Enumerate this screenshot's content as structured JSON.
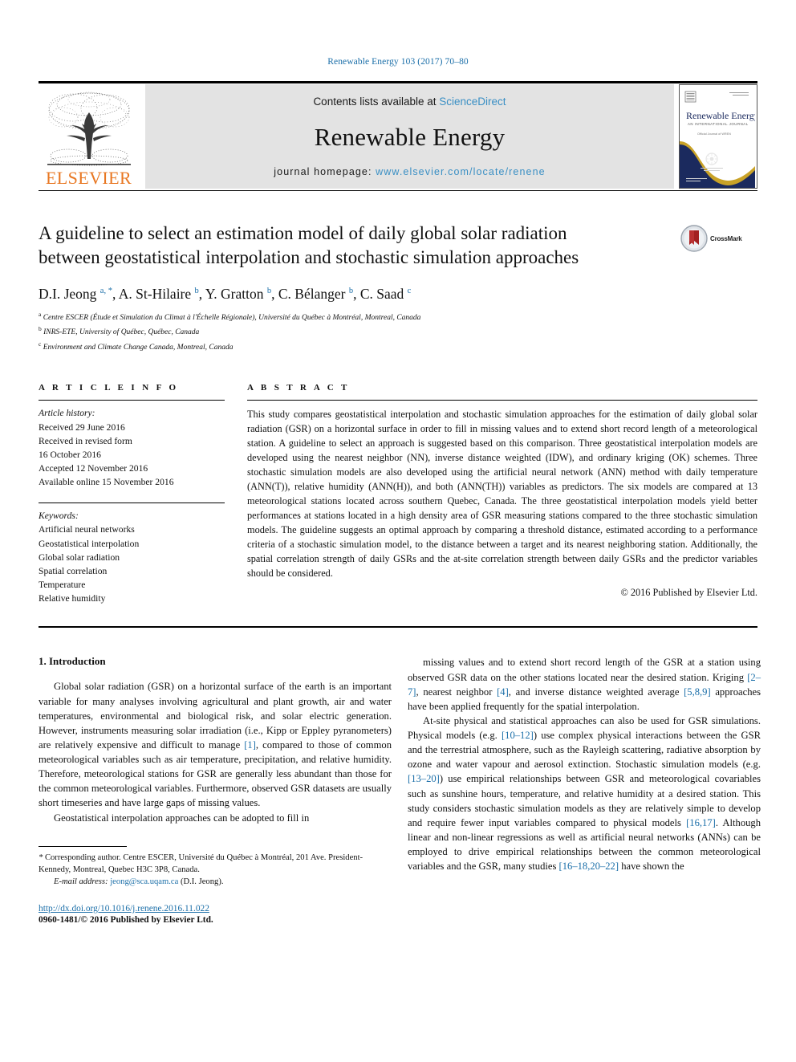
{
  "running_head": "Renewable Energy 103 (2017) 70–80",
  "masthead": {
    "publisher_name": "ELSEVIER",
    "contents_prefix": "Contents lists available at ",
    "contents_link": "ScienceDirect",
    "journal_title": "Renewable Energy",
    "homepage_prefix": "journal homepage: ",
    "homepage_url": "www.elsevier.com/locate/renene",
    "cover": {
      "title": "Renewable Energy",
      "subtitle": "AN INTERNATIONAL JOURNAL",
      "tagline": "Official Journal of WREN"
    }
  },
  "article": {
    "title": "A guideline to select an estimation model of daily global solar radiation between geostatistical interpolation and stochastic simulation approaches",
    "authors_html": "D.I. Jeong <sup>a, *</sup>, A. St-Hilaire <sup>b</sup>, Y. Gratton <sup>b</sup>, C. Bélanger <sup>b</sup>, C. Saad <sup>c</sup>",
    "affiliations": [
      "a Centre ESCER (Étude et Simulation du Climat à l'Échelle Régionale), Université du Québec à Montréal, Montreal, Canada",
      "b INRS-ETE, University of Québec, Québec, Canada",
      "c Environment and Climate Change Canada, Montreal, Canada"
    ],
    "crossmark_label": "CrossMark"
  },
  "article_info": {
    "heading": "A R T I C L E   I N F O",
    "history_label": "Article history:",
    "history": [
      "Received 29 June 2016",
      "Received in revised form",
      "16 October 2016",
      "Accepted 12 November 2016",
      "Available online 15 November 2016"
    ],
    "keywords_label": "Keywords:",
    "keywords": [
      "Artificial neural networks",
      "Geostatistical interpolation",
      "Global solar radiation",
      "Spatial correlation",
      "Temperature",
      "Relative humidity"
    ]
  },
  "abstract": {
    "heading": "A B S T R A C T",
    "text": "This study compares geostatistical interpolation and stochastic simulation approaches for the estimation of daily global solar radiation (GSR) on a horizontal surface in order to fill in missing values and to extend short record length of a meteorological station. A guideline to select an approach is suggested based on this comparison. Three geostatistical interpolation models are developed using the nearest neighbor (NN), inverse distance weighted (IDW), and ordinary kriging (OK) schemes. Three stochastic simulation models are also developed using the artificial neural network (ANN) method with daily temperature (ANN(T)), relative humidity (ANN(H)), and both (ANN(TH)) variables as predictors. The six models are compared at 13 meteorological stations located across southern Quebec, Canada. The three geostatistical interpolation models yield better performances at stations located in a high density area of GSR measuring stations compared to the three stochastic simulation models. The guideline suggests an optimal approach by comparing a threshold distance, estimated according to a performance criteria of a stochastic simulation model, to the distance between a target and its nearest neighboring station. Additionally, the spatial correlation strength of daily GSRs and the at-site correlation strength between daily GSRs and the predictor variables should be considered.",
    "copyright": "© 2016 Published by Elsevier Ltd."
  },
  "introduction": {
    "section_number_title": "1. Introduction",
    "left_paragraph_1_html": "Global solar radiation (GSR) on a horizontal surface of the earth is an important variable for many analyses involving agricultural and plant growth, air and water temperatures, environmental and biological risk, and solar electric generation. However, instruments measuring solar irradiation (i.e., Kipp or Eppley pyranometers) are relatively expensive and difficult to manage <span class=\"ref\">[1]</span>, compared to those of common meteorological variables such as air temperature, precipitation, and relative humidity. Therefore, meteorological stations for GSR are generally less abundant than those for the common meteorological variables. Furthermore, observed GSR datasets are usually short timeseries and have large gaps of missing values.",
    "left_paragraph_2_html": "Geostatistical interpolation approaches can be adopted to fill in",
    "right_paragraph_1_html": "missing values and to extend short record length of the GSR at a station using observed GSR data on the other stations located near the desired station. Kriging <span class=\"ref\">[2–7]</span>, nearest neighbor <span class=\"ref\">[4]</span>, and inverse distance weighted average <span class=\"ref\">[5,8,9]</span> approaches have been applied frequently for the spatial interpolation.",
    "right_paragraph_2_html": "At-site physical and statistical approaches can also be used for GSR simulations. Physical models (e.g. <span class=\"ref\">[10–12]</span>) use complex physical interactions between the GSR and the terrestrial atmosphere, such as the Rayleigh scattering, radiative absorption by ozone and water vapour and aerosol extinction. Stochastic simulation models (e.g. <span class=\"ref\">[13–20]</span>) use empirical relationships between GSR and meteorological covariables such as sunshine hours, temperature, and relative humidity at a desired station. This study considers stochastic simulation models as they are relatively simple to develop and require fewer input variables compared to physical models <span class=\"ref\">[16,17]</span>. Although linear and non-linear regressions as well as artificial neural networks (ANNs) can be employed to drive empirical relationships between the common meteorological variables and the GSR, many studies <span class=\"ref\">[16–18,20–22]</span> have shown the"
  },
  "footer": {
    "corresponding_html": "<span class=\"em\">*</span> Corresponding author. Centre ESCER, Université du Québec à Montréal, 201 Ave. President-Kennedy, Montreal, Quebec H3C 3P8, Canada.",
    "email_label": "E-mail address:",
    "email": "jeong@sca.uqam.ca",
    "email_suffix": "(D.I. Jeong).",
    "doi": "http://dx.doi.org/10.1016/j.renene.2016.11.022",
    "issn_line": "0960-1481/© 2016 Published by Elsevier Ltd."
  },
  "colors": {
    "link_blue": "#1a6ea8",
    "sciencedirect_blue": "#3a8fc4",
    "elsevier_orange": "#E87722",
    "masthead_gray": "#e3e3e3",
    "cover_navy": "#1b2a5e",
    "cover_gold": "#c9a227",
    "crossmark_red": "#a32020"
  }
}
